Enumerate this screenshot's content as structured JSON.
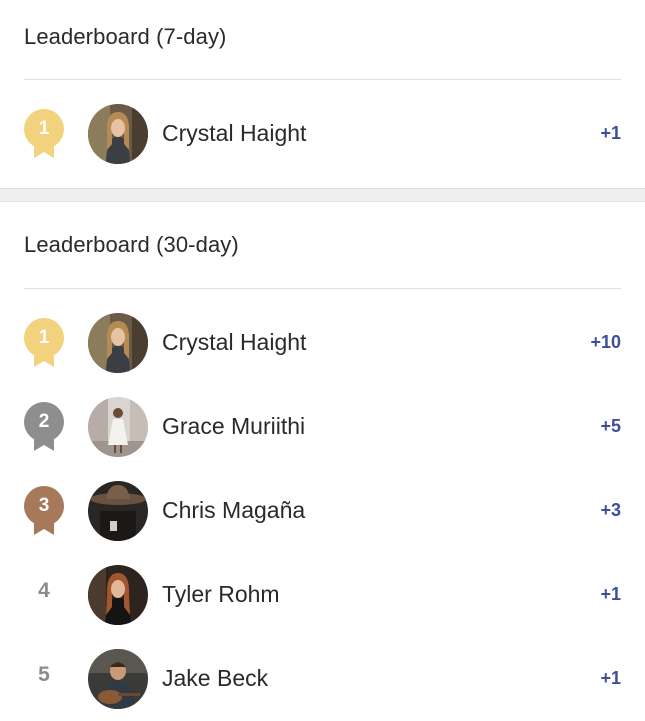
{
  "leaderboard_7": {
    "title": "Leaderboard (7-day)",
    "rows": [
      {
        "rank": "1",
        "medal": "gold",
        "name": "Crystal Haight",
        "score": "+1",
        "avatar": "woman-long-hair-avatar"
      }
    ]
  },
  "leaderboard_30": {
    "title": "Leaderboard (30-day)",
    "rows": [
      {
        "rank": "1",
        "medal": "gold",
        "name": "Crystal Haight",
        "score": "+10",
        "avatar": "woman-long-hair-avatar"
      },
      {
        "rank": "2",
        "medal": "silver",
        "name": "Grace Muriithi",
        "score": "+5",
        "avatar": "woman-white-dress-avatar"
      },
      {
        "rank": "3",
        "medal": "bronze",
        "name": "Chris Magaña",
        "score": "+3",
        "avatar": "man-cowboy-hat-avatar"
      },
      {
        "rank": "4",
        "medal": "none",
        "name": "Tyler Rohm",
        "score": "+1",
        "avatar": "woman-red-hair-avatar"
      },
      {
        "rank": "5",
        "medal": "none",
        "name": "Jake Beck",
        "score": "+1",
        "avatar": "man-guitar-avatar"
      }
    ]
  },
  "colors": {
    "gold": "#f2d27c",
    "silver": "#8e8e8e",
    "bronze": "#a5795a",
    "score": "#3d4f9a",
    "plain_rank": "#8c8c8c"
  }
}
